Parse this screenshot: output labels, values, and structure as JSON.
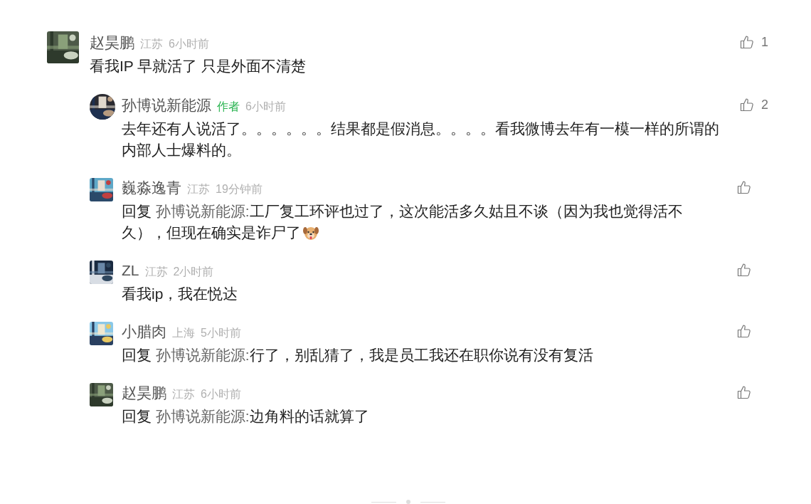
{
  "comments": [
    {
      "author": "赵昊鹏",
      "location": "江苏",
      "time": "6小时前",
      "likes": "1",
      "lines": [
        "看我IP 早就活了 只是外面不清楚"
      ],
      "replies": [
        {
          "author": "孙博说新能源",
          "author_badge": "作者",
          "time": "6小时前",
          "likes": "2",
          "lines": [
            "去年还有人说活了。。。。。。结果都是假消息。。。。看我微博去年有一模一样的所谓的",
            "内部人士爆料的。"
          ]
        },
        {
          "author": "巍淼逸青",
          "location": "江苏",
          "time": "19分钟前",
          "reply_label": "回复",
          "reply_to": "孙博说新能源:",
          "lines": [
            "工厂复工环评也过了，这次能活多久姑且不谈（因为我也觉得活不",
            "久），但现在确实是诈尸了"
          ],
          "emoji_after": true
        },
        {
          "author": "ZL",
          "location": "江苏",
          "time": "2小时前",
          "lines": [
            "看我ip，我在悦达"
          ]
        },
        {
          "author": "小腊肉",
          "location": "上海",
          "time": "5小时前",
          "reply_label": "回复",
          "reply_to": "孙博说新能源:",
          "lines": [
            "行了，别乱猜了，我是员工我还在职你说有没有复活"
          ]
        },
        {
          "author": "赵昊鹏",
          "location": "江苏",
          "time": "6小时前",
          "reply_label": "回复",
          "reply_to": "孙博说新能源:",
          "lines": [
            "边角料的话就算了"
          ]
        }
      ]
    }
  ]
}
